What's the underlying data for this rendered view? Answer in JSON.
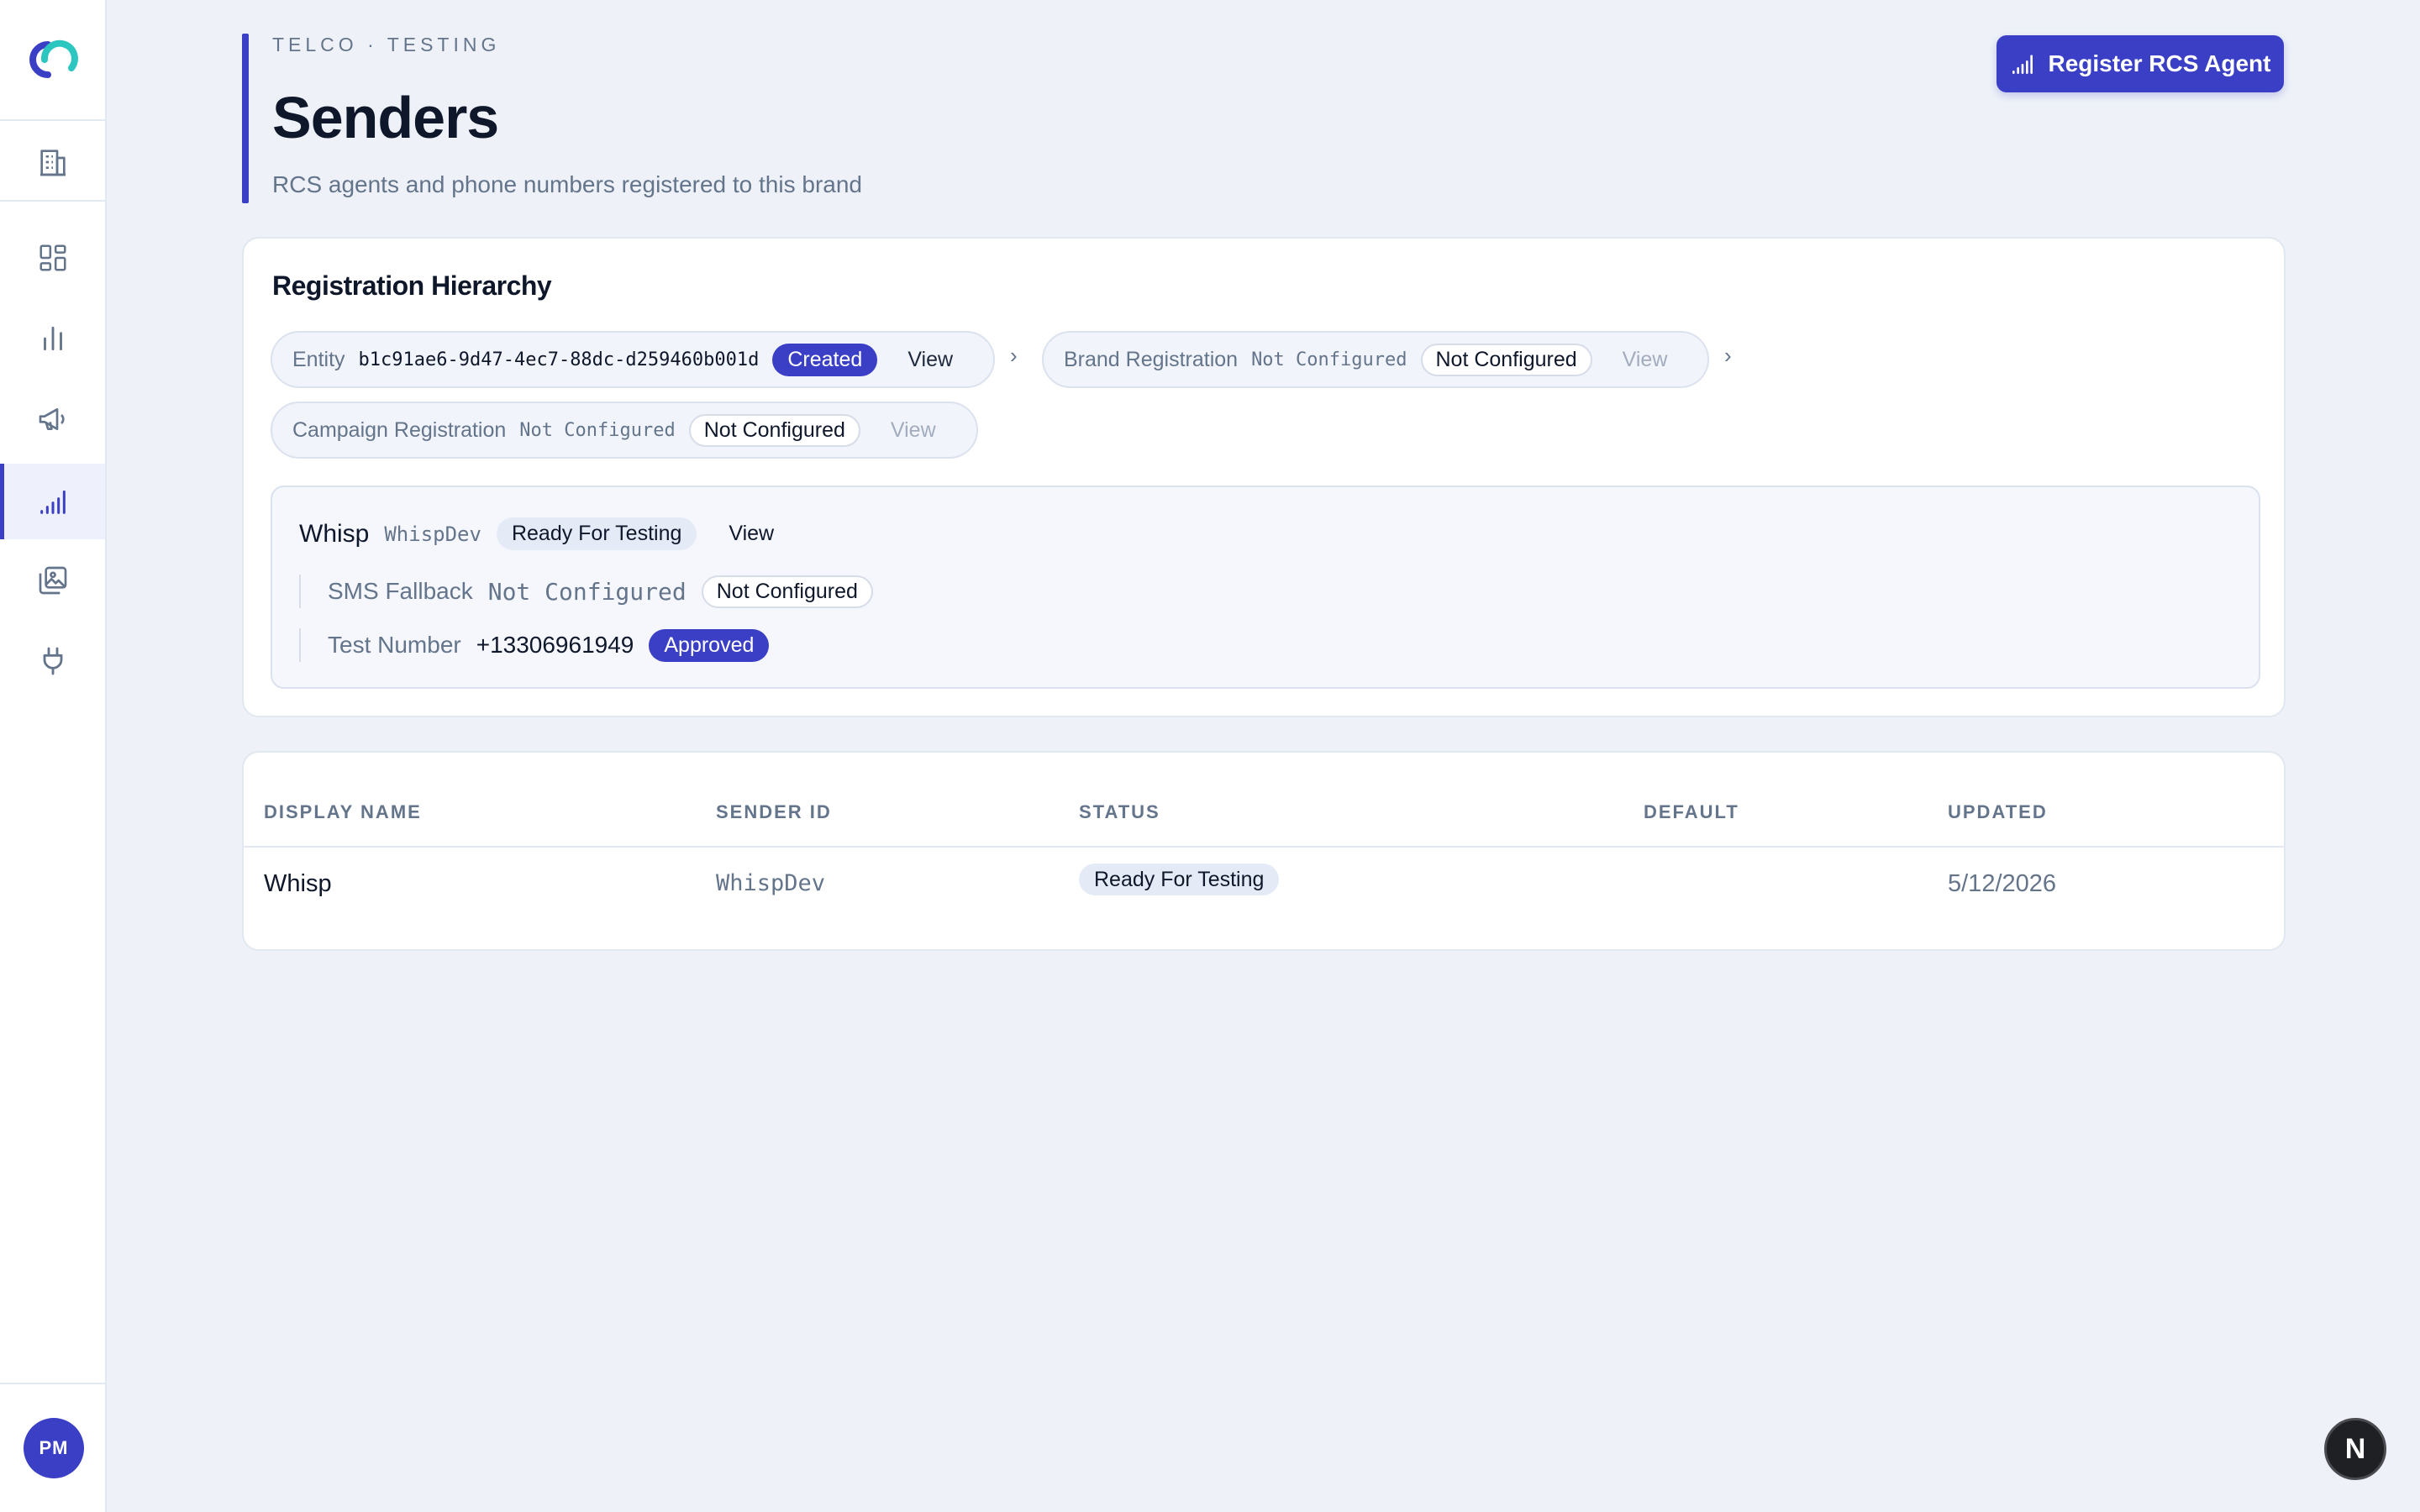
{
  "sidebar": {
    "user_initials": "PM",
    "icons": [
      "logo-icon",
      "building-icon",
      "dashboard-icon",
      "analytics-icon",
      "megaphone-icon",
      "signal-icon",
      "media-icon",
      "plug-icon"
    ],
    "accent": "#3a3fc5"
  },
  "header": {
    "breadcrumb": "TELCO · TESTING",
    "title": "Senders",
    "subtitle": "RCS agents and phone numbers registered to this brand",
    "primary_button": "Register RCS Agent"
  },
  "hierarchy": {
    "title": "Registration Hierarchy",
    "entity": {
      "label": "Entity",
      "value": "b1c91ae6-9d47-4ec7-88dc-d259460b001d",
      "status": "Created",
      "action": "View"
    },
    "brand": {
      "label": "Brand Registration",
      "value": "Not Configured",
      "status": "Not Configured",
      "action": "View"
    },
    "campaign": {
      "label": "Campaign Registration",
      "value": "Not Configured",
      "status": "Not Configured",
      "action": "View"
    },
    "agent": {
      "name": "Whisp",
      "id": "WhispDev",
      "status": "Ready For Testing",
      "action": "View",
      "sms_fallback": {
        "label": "SMS Fallback",
        "value": "Not Configured",
        "status": "Not Configured"
      },
      "test_number": {
        "label": "Test Number",
        "value": "+13306961949",
        "status": "Approved"
      }
    }
  },
  "table": {
    "columns": [
      "DISPLAY NAME",
      "SENDER ID",
      "STATUS",
      "DEFAULT",
      "UPDATED"
    ],
    "rows": [
      {
        "display_name": "Whisp",
        "sender_id": "WhispDev",
        "status": "Ready For Testing",
        "default": "",
        "updated": "5/12/2026"
      }
    ]
  },
  "corner_badge": "N"
}
